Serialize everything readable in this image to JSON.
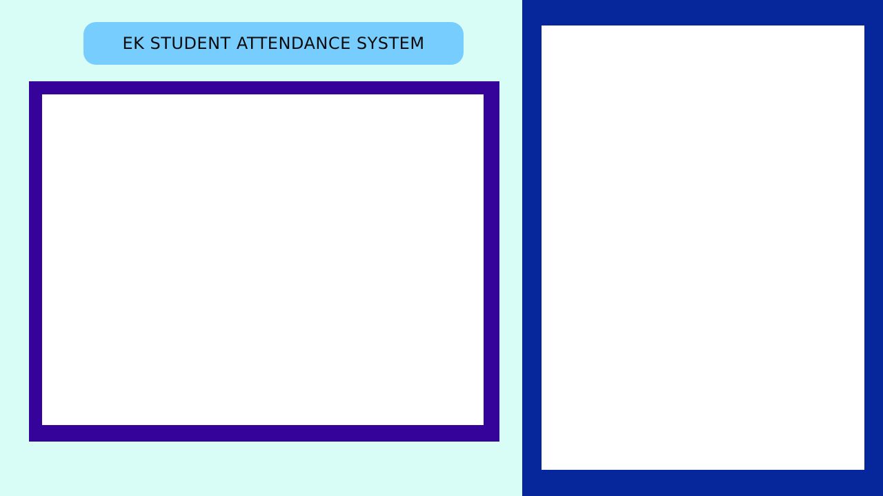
{
  "header": {
    "title": "EK STUDENT ATTENDANCE SYSTEM"
  },
  "colors": {
    "left_background": "#d8fcf6",
    "title_pill": "#78cdff",
    "camera_border": "#35039a",
    "right_background": "#05279b",
    "panel_fill": "#ffffff"
  }
}
